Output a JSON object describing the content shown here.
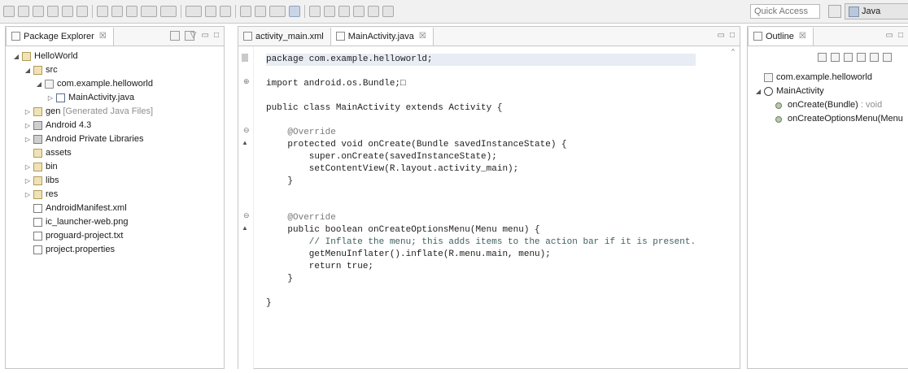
{
  "toolbar": {
    "quick_access_placeholder": "Quick Access",
    "perspective_label": "Java",
    "icons": [
      "new-icon",
      "save-icon",
      "save-all-icon",
      "print-icon",
      "sdk-manager-icon",
      "avd-manager-icon",
      "new-android-project-icon",
      "new-android-xml-icon",
      "lint-icon",
      "debug-icon",
      "run-icon",
      "external-tools-icon",
      "skip-breakpoints-icon",
      "new-java-package-icon",
      "new-java-class-icon",
      "open-type-icon",
      "search-icon",
      "toggle-mark-occurrences-icon",
      "next-annotation-icon",
      "previous-annotation-icon",
      "last-edit-location-icon",
      "back-icon",
      "forward-icon",
      "pin-editor-icon"
    ]
  },
  "package_explorer": {
    "title": "Package Explorer",
    "close": "☒",
    "tree": [
      {
        "label": "HelloWorld",
        "level": 0,
        "arrow": "◢",
        "icon": "project-icon"
      },
      {
        "label": "src",
        "level": 1,
        "arrow": "◢",
        "icon": "folder-icon"
      },
      {
        "label": "com.example.helloworld",
        "level": 2,
        "arrow": "◢",
        "icon": "package-icon"
      },
      {
        "label": "MainActivity.java",
        "level": 3,
        "arrow": "▷",
        "icon": "java-file-icon"
      },
      {
        "label": "gen",
        "decor": "[Generated Java Files]",
        "level": 1,
        "arrow": "▷",
        "icon": "folder-icon"
      },
      {
        "label": "Android 4.3",
        "level": 1,
        "arrow": "▷",
        "icon": "library-icon"
      },
      {
        "label": "Android Private Libraries",
        "level": 1,
        "arrow": "▷",
        "icon": "library-icon"
      },
      {
        "label": "assets",
        "level": 1,
        "arrow": "",
        "icon": "folder-icon"
      },
      {
        "label": "bin",
        "level": 1,
        "arrow": "▷",
        "icon": "folder-icon"
      },
      {
        "label": "libs",
        "level": 1,
        "arrow": "▷",
        "icon": "folder-icon"
      },
      {
        "label": "res",
        "level": 1,
        "arrow": "▷",
        "icon": "folder-icon"
      },
      {
        "label": "AndroidManifest.xml",
        "level": 1,
        "arrow": "",
        "icon": "xml-file-icon"
      },
      {
        "label": "ic_launcher-web.png",
        "level": 1,
        "arrow": "",
        "icon": "image-file-icon"
      },
      {
        "label": "proguard-project.txt",
        "level": 1,
        "arrow": "",
        "icon": "text-file-icon"
      },
      {
        "label": "project.properties",
        "level": 1,
        "arrow": "",
        "icon": "text-file-icon"
      }
    ]
  },
  "editor": {
    "tabs": [
      {
        "label": "activity_main.xml",
        "active": false,
        "close": ""
      },
      {
        "label": "MainActivity.java",
        "active": true,
        "close": "☒"
      }
    ],
    "lines": [
      {
        "text": "package com.example.helloworld;",
        "cls": "cur"
      },
      {
        "text": "",
        "cls": ""
      },
      {
        "text": "import android.os.Bundle;□",
        "cls": ""
      },
      {
        "text": "",
        "cls": ""
      },
      {
        "text": "public class MainActivity extends Activity {",
        "cls": ""
      },
      {
        "text": "",
        "cls": ""
      },
      {
        "text": "    @Override",
        "cls": "ann"
      },
      {
        "text": "    protected void onCreate(Bundle savedInstanceState) {",
        "cls": ""
      },
      {
        "text": "        super.onCreate(savedInstanceState);",
        "cls": ""
      },
      {
        "text": "        setContentView(R.layout.activity_main);",
        "cls": ""
      },
      {
        "text": "    }",
        "cls": ""
      },
      {
        "text": "",
        "cls": ""
      },
      {
        "text": "",
        "cls": ""
      },
      {
        "text": "    @Override",
        "cls": "ann"
      },
      {
        "text": "    public boolean onCreateOptionsMenu(Menu menu) {",
        "cls": ""
      },
      {
        "text": "        // Inflate the menu; this adds items to the action bar if it is present.",
        "cls": "cm"
      },
      {
        "text": "        getMenuInflater().inflate(R.menu.main, menu);",
        "cls": ""
      },
      {
        "text": "        return true;",
        "cls": ""
      },
      {
        "text": "    }",
        "cls": ""
      },
      {
        "text": "",
        "cls": ""
      },
      {
        "text": "}",
        "cls": ""
      }
    ]
  },
  "outline": {
    "title": "Outline",
    "close": "☒",
    "items": [
      {
        "label": "com.example.helloworld",
        "ret": "",
        "level": 0,
        "arrow": "",
        "icon": "package-declaration-icon"
      },
      {
        "label": "MainActivity",
        "ret": "",
        "level": 0,
        "arrow": "◢",
        "icon": "class-icon"
      },
      {
        "label": "onCreate(Bundle)",
        "ret": " : void",
        "level": 1,
        "arrow": "",
        "icon": "protected-method-icon"
      },
      {
        "label": "onCreateOptionsMenu(Menu",
        "ret": "",
        "level": 1,
        "arrow": "",
        "icon": "public-method-icon"
      }
    ]
  }
}
